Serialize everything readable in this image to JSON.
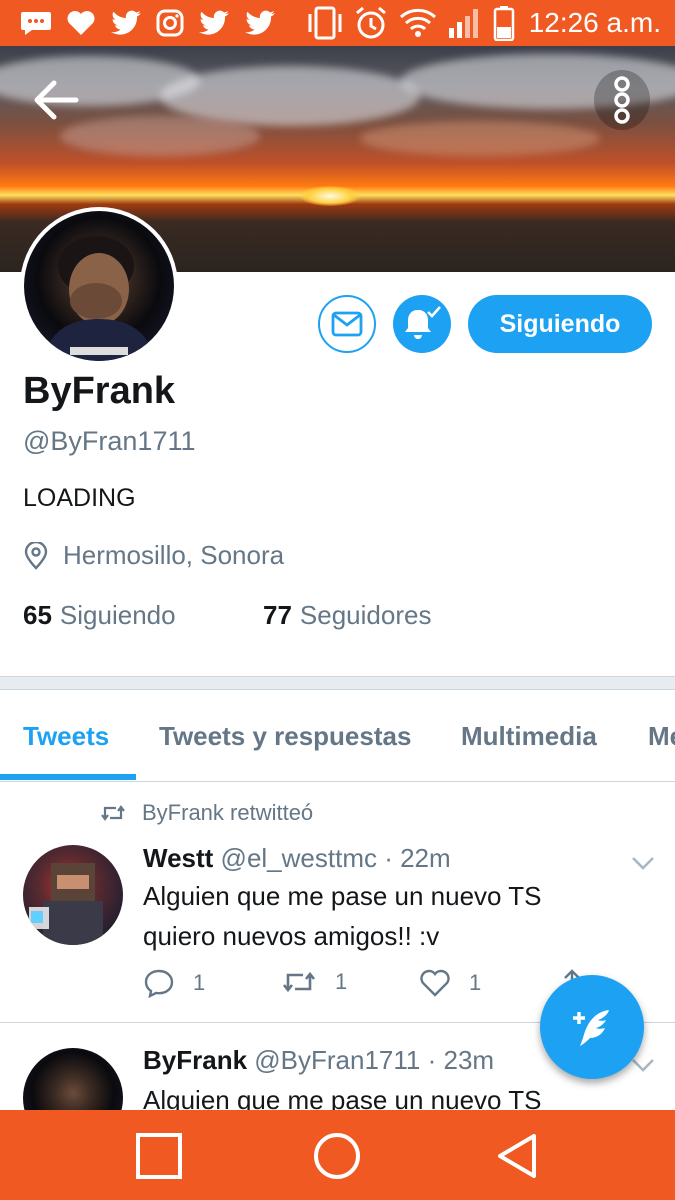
{
  "status_bar": {
    "time": "12:26 a.m.",
    "icons": [
      "chat-icon",
      "heart-icon",
      "twitter-icon",
      "instagram-icon",
      "twitter-icon",
      "twitter-icon",
      "vibrate-icon",
      "alarm-icon",
      "wifi-icon",
      "signal-icon",
      "battery-icon"
    ]
  },
  "header": {
    "back_icon": "arrow-left-icon",
    "more_icon": "more-vertical-icon"
  },
  "profile": {
    "name": "ByFrank",
    "handle": "@ByFran1711",
    "bio": "LOADING",
    "location": "Hermosillo, Sonora",
    "following_count": "65",
    "following_label": "Siguiendo",
    "followers_count": "77",
    "followers_label": "Seguidores",
    "follow_button": "Siguiendo"
  },
  "tabs": [
    {
      "label": "Tweets",
      "active": true
    },
    {
      "label": "Tweets y respuestas",
      "active": false
    },
    {
      "label": "Multimedia",
      "active": false
    },
    {
      "label": "Me",
      "active": false
    }
  ],
  "tweets": [
    {
      "retweeted_by": "ByFrank retwitteó",
      "author": "Westt",
      "handle": "@el_westtmc",
      "time": "· 22m",
      "lines": [
        "Alguien que me pase un nuevo TS",
        "quiero nuevos amigos!! :v"
      ],
      "replies": "1",
      "retweets": "1",
      "likes": "1"
    },
    {
      "author": "ByFrank",
      "handle": "@ByFran1711",
      "time": "· 23m",
      "lines": [
        "Alguien que me pase un nuevo TS"
      ]
    }
  ],
  "colors": {
    "accent": "#1da1f2",
    "bars": "#f05a22",
    "muted": "#657786"
  }
}
